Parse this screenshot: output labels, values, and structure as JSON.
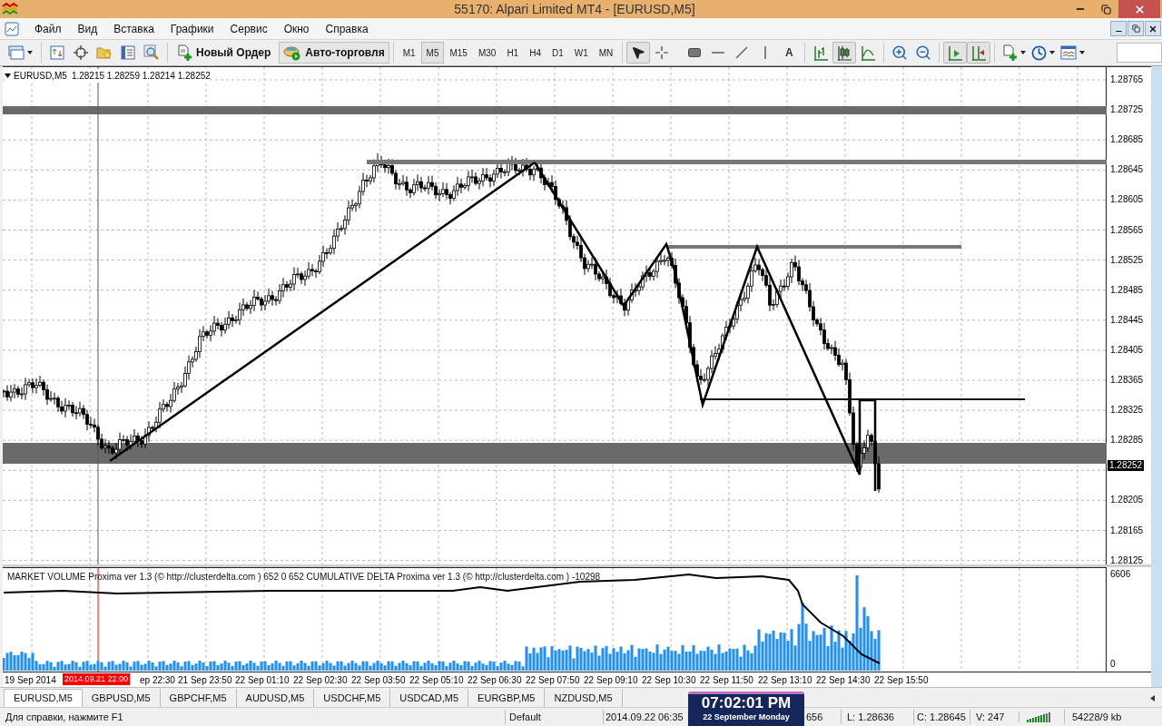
{
  "window": {
    "title": "55170: Alpari Limited MT4 - [EURUSD,M5]"
  },
  "menu": [
    "Файл",
    "Вид",
    "Вставка",
    "Графики",
    "Сервис",
    "Окно",
    "Справка"
  ],
  "toolbar": {
    "new_order": "Новый Ордер",
    "auto_trading": "Авто-торговля",
    "timeframes": [
      {
        "label": "M1",
        "selected": false
      },
      {
        "label": "M5",
        "selected": true
      },
      {
        "label": "M15",
        "selected": false
      },
      {
        "label": "M30",
        "selected": false
      },
      {
        "label": "H1",
        "selected": false
      },
      {
        "label": "H4",
        "selected": false
      },
      {
        "label": "D1",
        "selected": false
      },
      {
        "label": "W1",
        "selected": false
      },
      {
        "label": "MN",
        "selected": false
      }
    ],
    "drawing_tools": [
      {
        "kind": "cursor",
        "selected": true
      },
      {
        "kind": "crosshair",
        "selected": false
      },
      {
        "kind": "rectangle",
        "selected": false
      },
      {
        "kind": "hline",
        "selected": false
      },
      {
        "kind": "trendline",
        "selected": false
      },
      {
        "kind": "vline",
        "selected": false
      },
      {
        "kind": "text",
        "label": "A",
        "selected": false
      }
    ],
    "chart_types": [
      {
        "kind": "bars",
        "selected": false
      },
      {
        "kind": "candles",
        "selected": true
      },
      {
        "kind": "line",
        "selected": false
      }
    ],
    "chart_scroll": [
      {
        "kind": "autoscroll",
        "selected": true
      },
      {
        "kind": "shift",
        "selected": true
      }
    ]
  },
  "chart": {
    "symbol": "EURUSD,M5",
    "ohlc": "1.28215 1.28259 1.28214 1.28252",
    "price_ticks": [
      "1.28765",
      "1.28725",
      "1.28685",
      "1.28645",
      "1.28605",
      "1.28565",
      "1.28525",
      "1.28485",
      "1.28445",
      "1.28405",
      "1.28365",
      "1.28325",
      "1.28285",
      "1.28205",
      "1.28165",
      "1.28125"
    ],
    "current_price": "1.28252",
    "indicator_label": "MARKET VOLUME Proxima ver 1.3 (© http://clusterdelta.com ) 652 0 652  CUMULATIVE DELTA Proxima ver 1.3 (© http://clusterdelta.com ) -10298",
    "indicator_ticks": [
      "6606",
      "0"
    ],
    "cursor_time": "2014.09.21 22:00",
    "time_labels": [
      "19 Sep 2014",
      "ep 22:30",
      "21 Sep 23:50",
      "22 Sep 01:10",
      "22 Sep 02:30",
      "22 Sep 03:50",
      "22 Sep 05:10",
      "22 Sep 06:30",
      "22 Sep 07:50",
      "22 Sep 09:10",
      "22 Sep 10:30",
      "22 Sep 11:50",
      "22 Sep 13:10",
      "22 Sep 14:30",
      "22 Sep 15:50"
    ]
  },
  "tabs": [
    {
      "label": "EURUSD,M5",
      "selected": true
    },
    {
      "label": "GBPUSD,M5",
      "selected": false
    },
    {
      "label": "GBPCHF,M5",
      "selected": false
    },
    {
      "label": "AUDUSD,M5",
      "selected": false
    },
    {
      "label": "USDCHF,M5",
      "selected": false
    },
    {
      "label": "USDCAD,M5",
      "selected": false
    },
    {
      "label": "EURGBP,M5",
      "selected": false
    },
    {
      "label": "NZDUSD,M5",
      "selected": false
    }
  ],
  "status_bar": {
    "help": "Для справки, нажмите F1",
    "profile": "Default",
    "time": "2014.09.22 06:35",
    "partial_value": "656",
    "low": "L: 1.28636",
    "close": "C: 1.28645",
    "volume": "V: 247",
    "traffic": "54228/9 kb"
  },
  "clock": {
    "time": "07:02:01 PM",
    "date": "22 September Monday"
  }
}
